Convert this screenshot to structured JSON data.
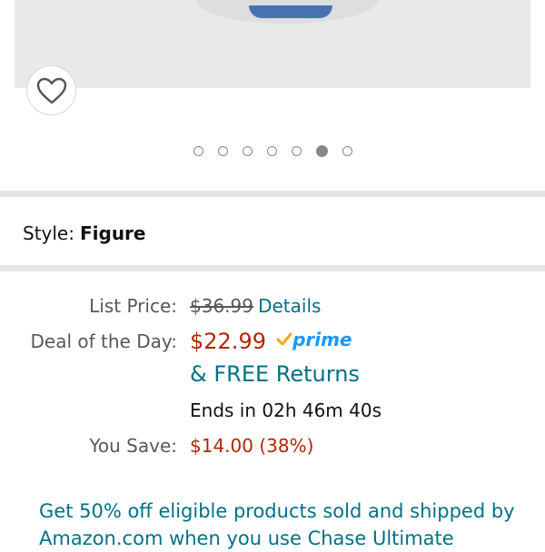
{
  "product": {
    "image_dots_count": 7,
    "active_dot_index": 5
  },
  "style": {
    "label": "Style:",
    "value": "Figure"
  },
  "pricing": {
    "list_price_label": "List Price:",
    "list_price": "$36.99",
    "details_link": "Details",
    "deal_label": "Deal of the Day:",
    "deal_price": "$22.99",
    "prime": "prime",
    "free_returns": "& FREE Returns",
    "ends_in": "Ends in 02h 46m 40s",
    "you_save_label": "You Save:",
    "you_save": "$14.00 (38%)"
  },
  "promo": {
    "text": "Get 50% off eligible products sold and shipped by Amazon.com when you use Chase Ultimate"
  },
  "colors": {
    "price_red": "#b12704",
    "link_teal": "#007185",
    "prime_blue": "#1a98ff",
    "prime_check": "#f7a51c"
  }
}
